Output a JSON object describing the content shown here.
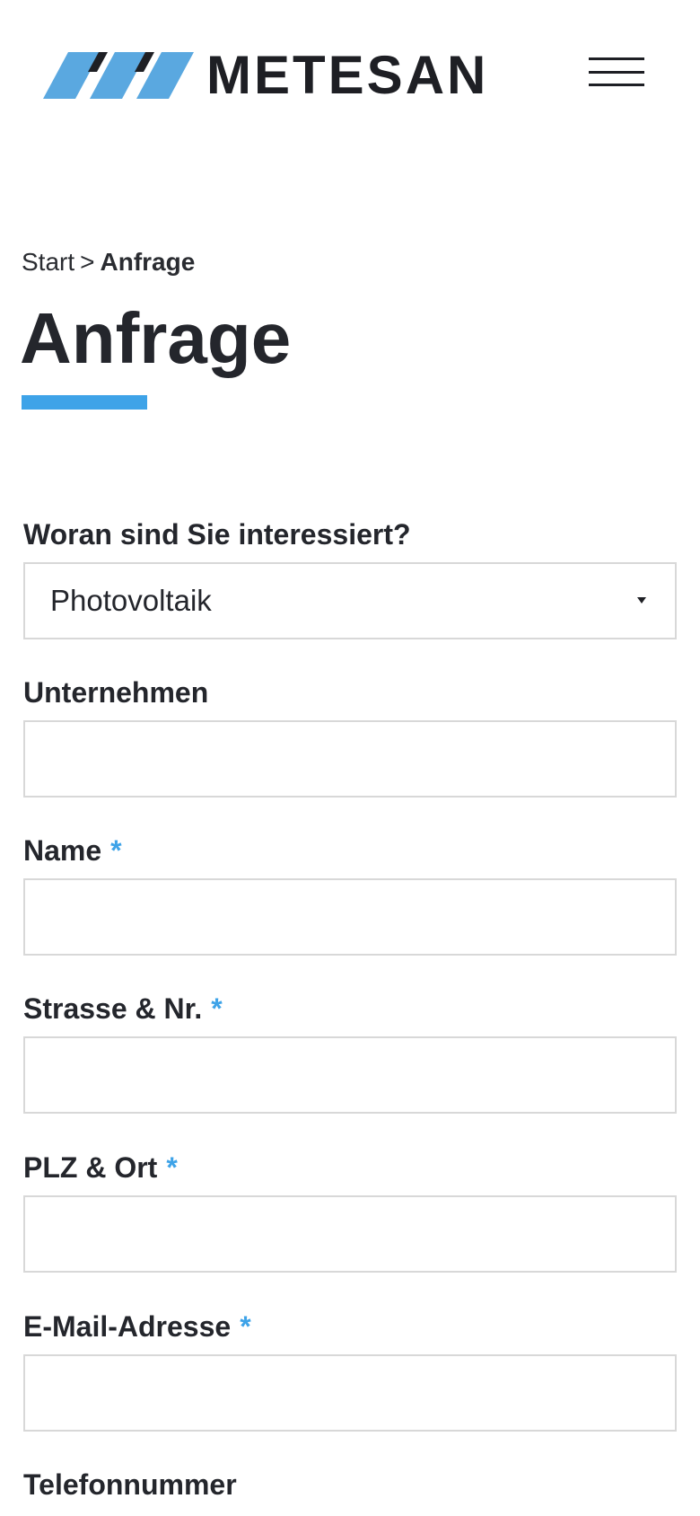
{
  "header": {
    "brand_name": "METESAN",
    "menu_icon": "hamburger-menu-icon",
    "logo_colors": {
      "blue": "#5aa8e0",
      "dark": "#1e1f24"
    }
  },
  "breadcrumb": {
    "home": "Start",
    "separator": ">",
    "current": "Anfrage"
  },
  "page": {
    "title": "Anfrage",
    "accent_color": "#3ea3e8"
  },
  "form": {
    "interest": {
      "label": "Woran sind Sie interessiert?",
      "value": "Photovoltaik"
    },
    "company": {
      "label": "Unternehmen",
      "value": ""
    },
    "name": {
      "label": "Name",
      "required_mark": "*",
      "value": ""
    },
    "street": {
      "label": "Strasse & Nr.",
      "required_mark": "*",
      "value": ""
    },
    "city": {
      "label": "PLZ & Ort",
      "required_mark": "*",
      "value": ""
    },
    "email": {
      "label": "E-Mail-Adresse",
      "required_mark": "*",
      "value": ""
    },
    "phone": {
      "label": "Telefonnummer"
    }
  }
}
